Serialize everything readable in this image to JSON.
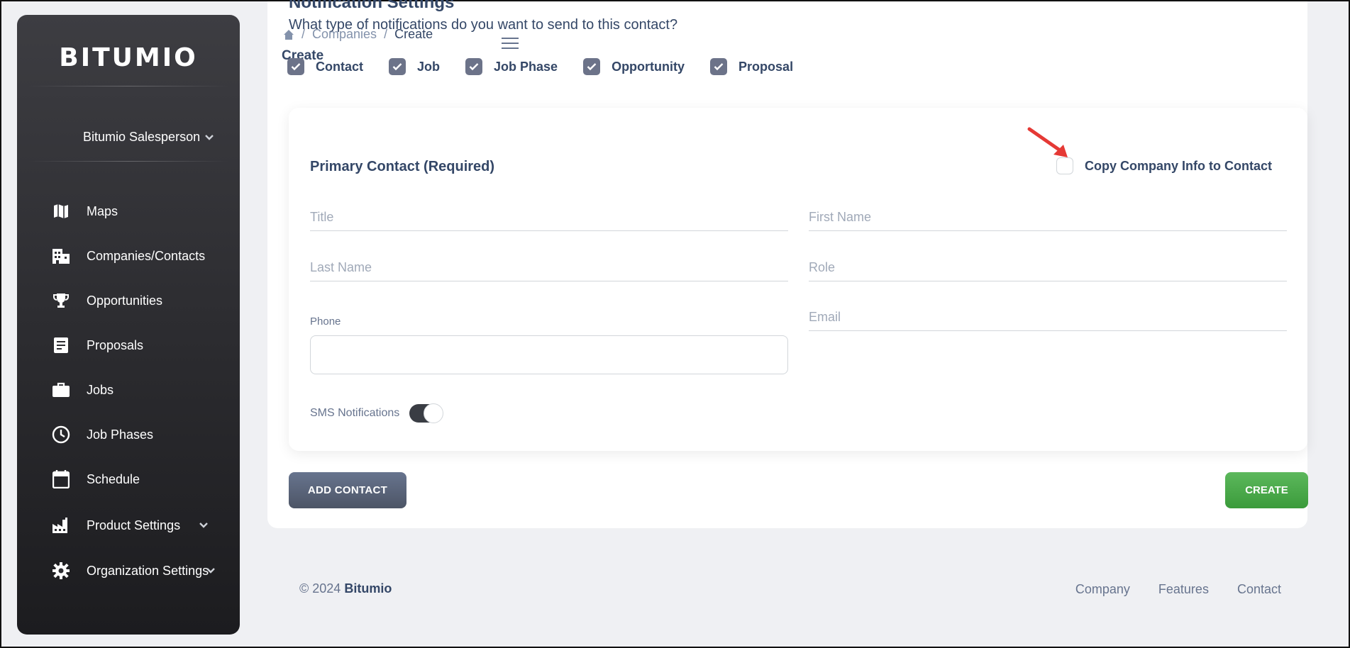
{
  "sidebar": {
    "logo": "BITUMIO",
    "user": "Bitumio Salesperson",
    "items": [
      {
        "label": "Maps",
        "icon": "map-icon"
      },
      {
        "label": "Companies/Contacts",
        "icon": "building-icon"
      },
      {
        "label": "Opportunities",
        "icon": "trophy-icon"
      },
      {
        "label": "Proposals",
        "icon": "document-icon"
      },
      {
        "label": "Jobs",
        "icon": "briefcase-icon"
      },
      {
        "label": "Job Phases",
        "icon": "clock-icon"
      },
      {
        "label": "Schedule",
        "icon": "calendar-icon"
      },
      {
        "label": "Product Settings",
        "icon": "factory-icon"
      },
      {
        "label": "Organization Settings",
        "icon": "gear-icon"
      }
    ]
  },
  "header": {
    "section_title": "Notification Settings",
    "question": "What type of notifications do you want to send to this contact?",
    "breadcrumb": {
      "companies": "Companies",
      "current": "Create",
      "separator": "/"
    },
    "page_title": "Create"
  },
  "notifications": [
    {
      "label": "Contact",
      "checked": true
    },
    {
      "label": "Job",
      "checked": true
    },
    {
      "label": "Job Phase",
      "checked": true
    },
    {
      "label": "Opportunity",
      "checked": true
    },
    {
      "label": "Proposal",
      "checked": true
    }
  ],
  "contact_card": {
    "title": "Primary Contact (Required)",
    "copy_label": "Copy Company Info to Contact",
    "copy_checked": false,
    "fields": {
      "title_placeholder": "Title",
      "first_name_placeholder": "First Name",
      "last_name_placeholder": "Last Name",
      "role_placeholder": "Role",
      "phone_label": "Phone",
      "email_placeholder": "Email"
    },
    "sms_label": "SMS Notifications",
    "sms_enabled": true
  },
  "buttons": {
    "add_contact": "ADD CONTACT",
    "create": "CREATE"
  },
  "footer": {
    "copyright_prefix": "© 2024",
    "brand": "Bitumio",
    "links": [
      "Company",
      "Features",
      "Contact"
    ]
  },
  "colors": {
    "accent_green": "#4caf50",
    "annotation_arrow": "#e53935"
  }
}
